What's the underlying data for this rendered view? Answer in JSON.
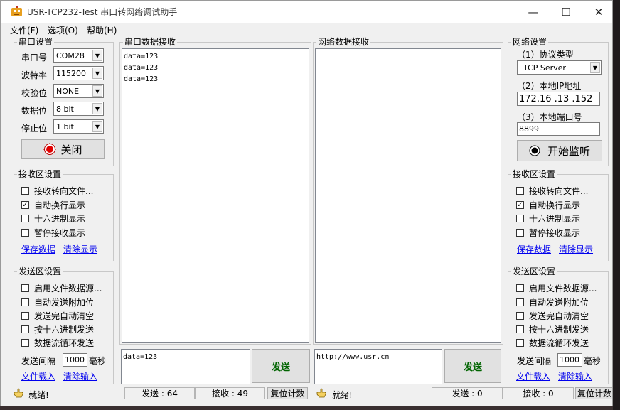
{
  "window": {
    "title": "USR-TCP232-Test 串口转网络调试助手",
    "controls": {
      "minimize": "—",
      "maximize": "☐",
      "close": "✕"
    }
  },
  "menu": [
    "文件(F)",
    "选项(O)",
    "帮助(H)"
  ],
  "serial_settings": {
    "legend": "串口设置",
    "port_label": "串口号",
    "port_value": "COM28",
    "baud_label": "波特率",
    "baud_value": "115200",
    "parity_label": "校验位",
    "parity_value": "NONE",
    "databits_label": "数据位",
    "databits_value": "8 bit",
    "stopbits_label": "停止位",
    "stopbits_value": "1 bit",
    "close_button": "关闭"
  },
  "serial_recv_settings": {
    "legend": "接收区设置",
    "options": [
      {
        "label": "接收转向文件...",
        "checked": false
      },
      {
        "label": "自动换行显示",
        "checked": true
      },
      {
        "label": "十六进制显示",
        "checked": false
      },
      {
        "label": "暂停接收显示",
        "checked": false
      }
    ],
    "save_link": "保存数据",
    "clear_link": "清除显示"
  },
  "serial_send_settings": {
    "legend": "发送区设置",
    "options": [
      {
        "label": "启用文件数据源...",
        "checked": false
      },
      {
        "label": "自动发送附加位",
        "checked": false
      },
      {
        "label": "发送完自动清空",
        "checked": false
      },
      {
        "label": "按十六进制发送",
        "checked": false
      },
      {
        "label": "数据流循环发送",
        "checked": false
      }
    ],
    "interval_label": "发送间隔",
    "interval_value": "1000",
    "interval_unit": "毫秒",
    "load_link": "文件载入",
    "clear_link": "清除输入"
  },
  "serial_recv": {
    "legend": "串口数据接收",
    "lines": [
      "data=123",
      "data=123",
      "data=123"
    ]
  },
  "net_recv": {
    "legend": "网络数据接收",
    "lines": []
  },
  "serial_send": {
    "text": "data=123",
    "button": "发送"
  },
  "net_send": {
    "text": "http://www.usr.cn",
    "button": "发送"
  },
  "net_settings": {
    "legend": "网络设置",
    "protocol_label": "（1）协议类型",
    "protocol_value": "TCP Server",
    "ip_label": "（2）本地IP地址",
    "ip_value": "172.16 .13 .152",
    "port_label": "（3）本地端口号",
    "port_value": "8899",
    "listen_button": "开始监听"
  },
  "net_recv_settings": {
    "legend": "接收区设置",
    "options": [
      {
        "label": "接收转向文件...",
        "checked": false
      },
      {
        "label": "自动换行显示",
        "checked": true
      },
      {
        "label": "十六进制显示",
        "checked": false
      },
      {
        "label": "暂停接收显示",
        "checked": false
      }
    ],
    "save_link": "保存数据",
    "clear_link": "清除显示"
  },
  "net_send_settings": {
    "legend": "发送区设置",
    "options": [
      {
        "label": "启用文件数据源...",
        "checked": false
      },
      {
        "label": "自动发送附加位",
        "checked": false
      },
      {
        "label": "发送完自动清空",
        "checked": false
      },
      {
        "label": "按十六进制发送",
        "checked": false
      },
      {
        "label": "数据流循环发送",
        "checked": false
      }
    ],
    "interval_label": "发送间隔",
    "interval_value": "1000",
    "interval_unit": "毫秒",
    "load_link": "文件载入",
    "clear_link": "清除输入"
  },
  "status_left": {
    "ready": "就绪!",
    "sent": "发送 : 64",
    "received": "接收 : 49",
    "reset": "复位计数"
  },
  "status_right": {
    "ready": "就绪!",
    "sent": "发送 : 0",
    "received": "接收 : 0",
    "reset": "复位计数"
  }
}
